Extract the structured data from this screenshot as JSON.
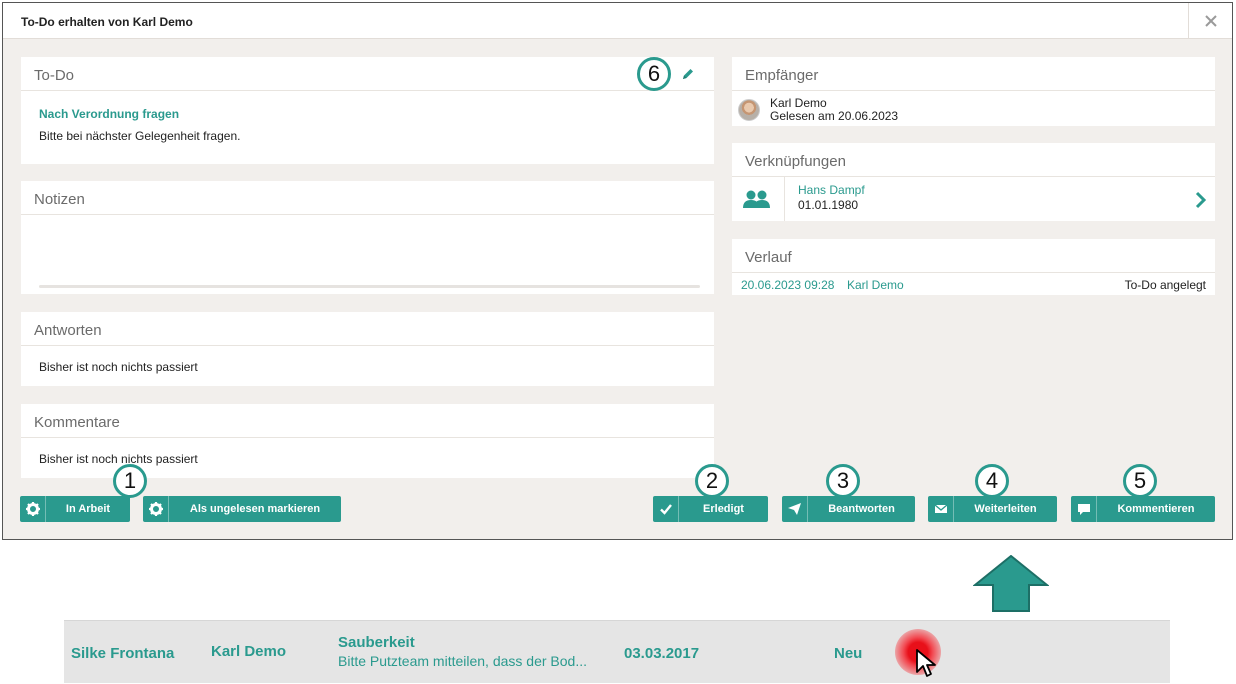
{
  "dialog": {
    "title": "To-Do erhalten von Karl Demo",
    "close_icon": "close-icon"
  },
  "todo_panel": {
    "heading": "To-Do",
    "title": "Nach Verordnung fragen",
    "text": "Bitte bei nächster Gelegenheit fragen.",
    "edit_icon": "pencil-icon"
  },
  "notes_panel": {
    "heading": "Notizen"
  },
  "answers_panel": {
    "heading": "Antworten",
    "empty_text": "Bisher ist noch nichts passiert"
  },
  "comments_panel": {
    "heading": "Kommentare",
    "empty_text": "Bisher ist noch nichts passiert"
  },
  "recipient_panel": {
    "heading": "Empfänger",
    "name": "Karl Demo",
    "read_status": "Gelesen am 20.06.2023"
  },
  "links_panel": {
    "heading": "Verknüpfungen",
    "name": "Hans Dampf",
    "date": "01.01.1980",
    "icon": "people-icon"
  },
  "history_panel": {
    "heading": "Verlauf",
    "entries": [
      {
        "datetime": "20.06.2023 09:28",
        "user": "Karl Demo",
        "action": "To-Do angelegt"
      }
    ]
  },
  "buttons": {
    "in_progress": "In Arbeit",
    "mark_unread": "Als ungelesen markieren",
    "done": "Erledigt",
    "reply": "Beantworten",
    "forward": "Weiterleiten",
    "comment": "Kommentieren"
  },
  "callouts": [
    "1",
    "2",
    "3",
    "4",
    "5",
    "6"
  ],
  "list_row": {
    "sender": "Silke Frontana",
    "recipient": "Karl Demo",
    "subject": "Sauberkeit",
    "preview": "Bitte Putzteam mitteilen, dass der Bod...",
    "date": "03.03.2017",
    "status": "Neu"
  },
  "colors": {
    "accent": "#2a9a8e",
    "background": "#f2efec",
    "cursor_highlight": "#e8101a"
  }
}
